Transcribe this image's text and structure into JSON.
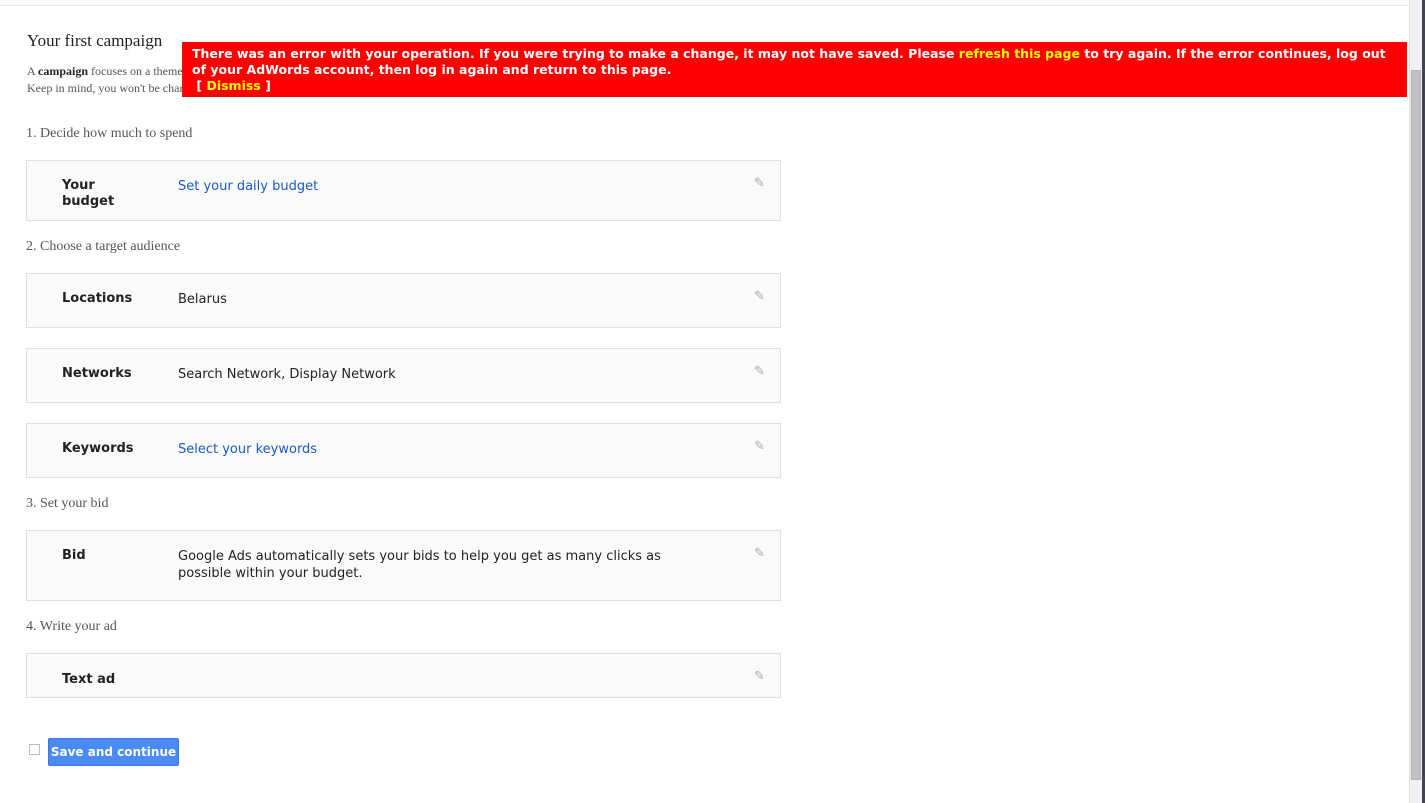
{
  "page": {
    "title": "Your first campaign",
    "intro_line1_prefix": "A ",
    "intro_bold": "campaign",
    "intro_line1_rest": " focuses on a theme",
    "intro_line2": "Keep in mind, you won't be charged"
  },
  "error": {
    "text1": "There was an error with your operation. If you were trying to make a change, it may not have saved. Please ",
    "link": "refresh this page",
    "text2": " to try again. If the error continues, log out of your AdWords account, then log in again and return to this page.",
    "dismiss_open": "[ ",
    "dismiss": "Dismiss",
    "dismiss_close": " ]"
  },
  "steps": [
    "1. Decide how much to spend",
    "2. Choose a target audience",
    "3. Set your bid",
    "4. Write your ad"
  ],
  "cards": [
    {
      "label": "Your budget",
      "value": "Set your daily budget"
    },
    {
      "label": "Locations",
      "value": "Belarus"
    },
    {
      "label": "Networks",
      "value": "Search Network, Display Network"
    },
    {
      "label": "Keywords",
      "value": "Select your keywords"
    },
    {
      "label": "Bid",
      "value": "Google Ads automatically sets your bids to help you get as many clicks as possible within your budget."
    },
    {
      "label": "Text ad",
      "value": ""
    }
  ],
  "save_label": "Save and continue",
  "colors": {
    "error_bg": "#ff0000",
    "link": "#1a5bc4",
    "button": "#4a8af4"
  }
}
